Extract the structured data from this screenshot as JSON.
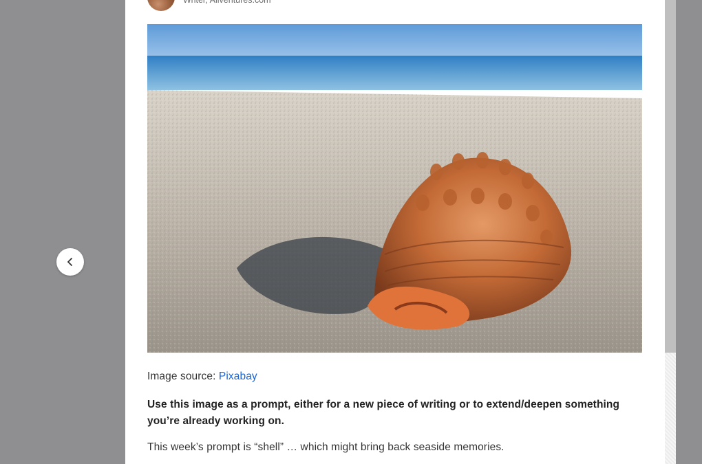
{
  "author": {
    "role": "Writer, Aliventures.com"
  },
  "image": {
    "alt": "Seashell on a sandy beach with the sea in the background"
  },
  "caption": {
    "label": "Image source: ",
    "link_text": "Pixabay"
  },
  "intro": "Use this image as a prompt, either for a new piece of writing or to extend/deepen something you’re already working on.",
  "body": "This week’s prompt is “shell” … which might bring back seaside memories.",
  "icons": {
    "prev": "chevron-left-icon"
  },
  "colors": {
    "overlay": "#8f8f91",
    "link": "#1a64d6",
    "panel": "#ffffff"
  }
}
